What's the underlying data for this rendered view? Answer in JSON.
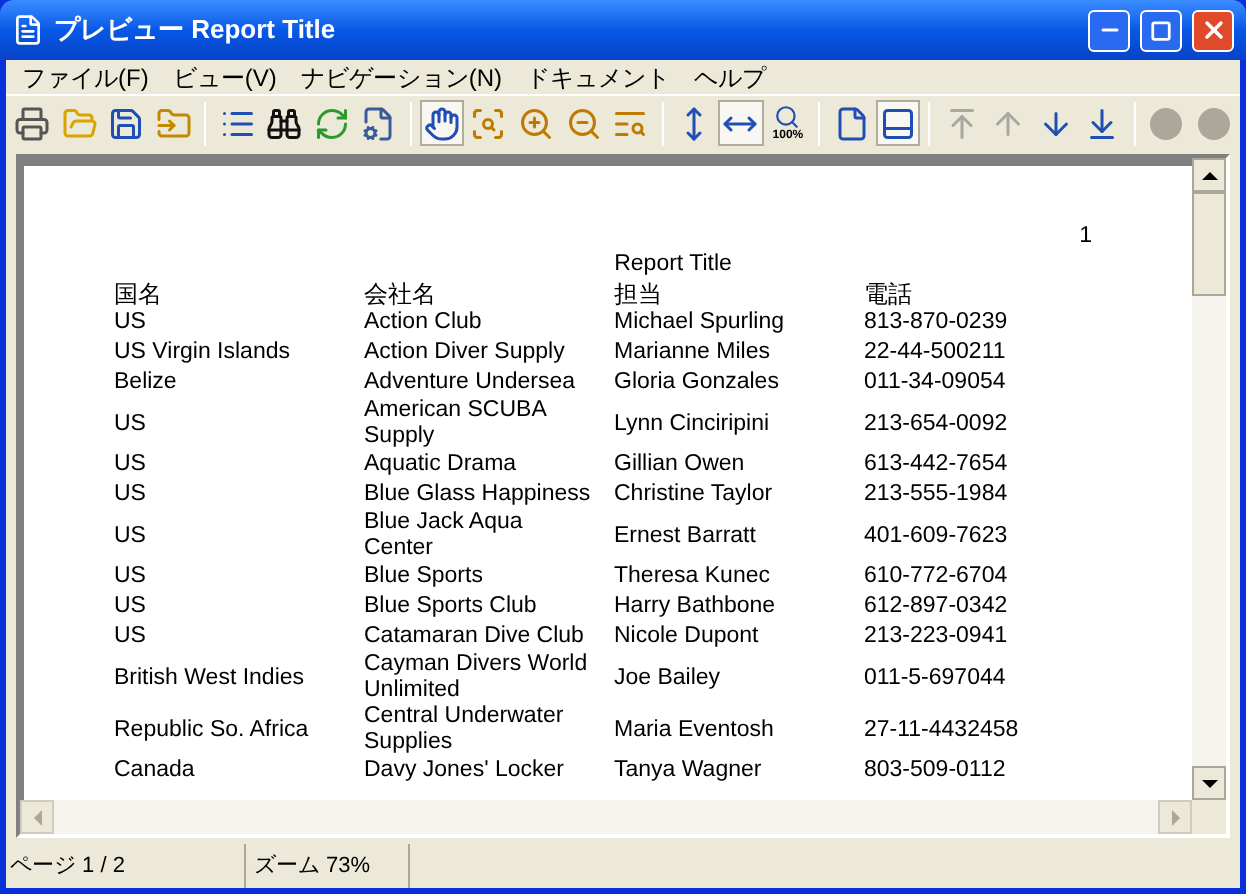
{
  "window": {
    "title": "プレビュー Report Title"
  },
  "menu": [
    "ファイル(F)",
    "ビュー(V)",
    "ナビゲーション(N)",
    "ドキュメント",
    "ヘルプ"
  ],
  "toolbar": [
    {
      "kind": "print",
      "pressed": false,
      "disabled": false
    },
    {
      "kind": "open",
      "pressed": false,
      "disabled": false
    },
    {
      "kind": "save",
      "pressed": false,
      "disabled": false
    },
    {
      "kind": "export",
      "pressed": false,
      "disabled": false
    },
    {
      "kind": "separator"
    },
    {
      "kind": "contents",
      "pressed": false,
      "disabled": false
    },
    {
      "kind": "find",
      "pressed": false,
      "disabled": false
    },
    {
      "kind": "refresh",
      "pressed": false,
      "disabled": false
    },
    {
      "kind": "page-setup",
      "pressed": false,
      "disabled": false
    },
    {
      "kind": "separator"
    },
    {
      "kind": "hand",
      "pressed": true,
      "disabled": false
    },
    {
      "kind": "zoom-fit",
      "pressed": false,
      "disabled": false
    },
    {
      "kind": "zoom-in",
      "pressed": false,
      "disabled": false
    },
    {
      "kind": "zoom-out",
      "pressed": false,
      "disabled": false
    },
    {
      "kind": "zoom-region",
      "pressed": false,
      "disabled": false
    },
    {
      "kind": "separator"
    },
    {
      "kind": "fit-height",
      "pressed": false,
      "disabled": false
    },
    {
      "kind": "fit-width",
      "pressed": true,
      "disabled": false
    },
    {
      "kind": "zoom-100",
      "label": "100%",
      "pressed": false,
      "disabled": false
    },
    {
      "kind": "separator"
    },
    {
      "kind": "single-page",
      "pressed": false,
      "disabled": false
    },
    {
      "kind": "two-page",
      "pressed": true,
      "disabled": false
    },
    {
      "kind": "separator"
    },
    {
      "kind": "first",
      "pressed": false,
      "disabled": true
    },
    {
      "kind": "prev",
      "pressed": false,
      "disabled": true
    },
    {
      "kind": "next",
      "pressed": false,
      "disabled": false
    },
    {
      "kind": "last",
      "pressed": false,
      "disabled": false
    },
    {
      "kind": "separator"
    },
    {
      "kind": "circle",
      "pressed": false,
      "disabled": true
    },
    {
      "kind": "circle",
      "pressed": false,
      "disabled": true
    }
  ],
  "report": {
    "page_number": "1",
    "title": "Report Title",
    "columns": [
      "国名",
      "会社名",
      "担当",
      "電話"
    ],
    "rows": [
      [
        "US",
        "Action Club",
        "Michael Spurling",
        "813-870-0239"
      ],
      [
        "US Virgin Islands",
        "Action Diver Supply",
        "Marianne Miles",
        "22-44-500211"
      ],
      [
        "Belize",
        "Adventure Undersea",
        "Gloria Gonzales",
        "011-34-09054"
      ],
      [
        "US",
        "American SCUBA\nSupply",
        "Lynn Cinciripini",
        "213-654-0092"
      ],
      [
        "US",
        "Aquatic Drama",
        "Gillian Owen",
        "613-442-7654"
      ],
      [
        "US",
        "Blue Glass Happiness",
        "Christine Taylor",
        "213-555-1984"
      ],
      [
        "US",
        "Blue Jack Aqua\nCenter",
        "Ernest Barratt",
        "401-609-7623"
      ],
      [
        "US",
        "Blue Sports",
        "Theresa Kunec",
        "610-772-6704"
      ],
      [
        "US",
        "Blue Sports Club",
        "Harry Bathbone",
        "612-897-0342"
      ],
      [
        "US",
        "Catamaran Dive Club",
        "Nicole Dupont",
        "213-223-0941"
      ],
      [
        "British West Indies",
        "Cayman Divers World\nUnlimited",
        "Joe Bailey",
        "011-5-697044"
      ],
      [
        "Republic So. Africa",
        "Central Underwater\nSupplies",
        "Maria Eventosh",
        "27-11-4432458"
      ],
      [
        "Canada",
        "Davy Jones' Locker",
        "Tanya Wagner",
        "803-509-0112"
      ]
    ]
  },
  "status_bar": [
    "ページ 1 / 2",
    "ズーム 73%"
  ]
}
